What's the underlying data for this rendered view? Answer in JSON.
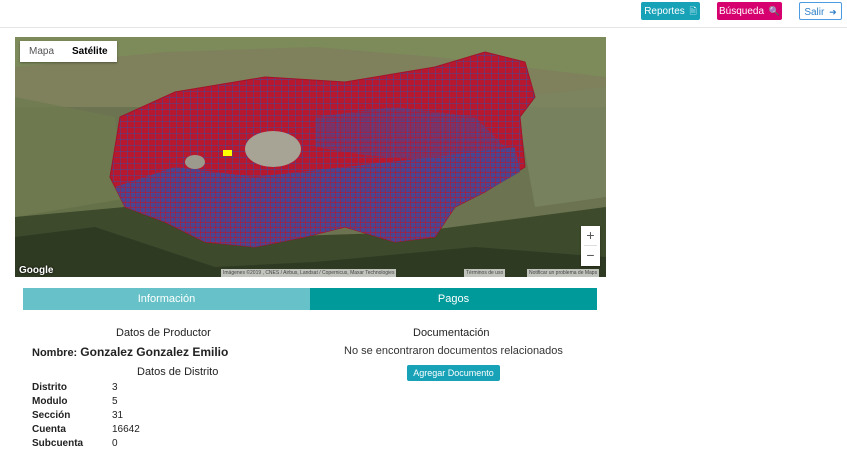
{
  "topbar": {
    "reportes_label": "Reportes",
    "busqueda_label": "Búsqueda",
    "salir_label": "Salir",
    "icons": [
      "document-icon",
      "search-icon",
      "logout-icon"
    ]
  },
  "map": {
    "toggle": [
      "Mapa",
      "Satélite"
    ],
    "selected_view": "Satélite",
    "zoom_in": "+",
    "zoom_out": "−",
    "google_label": "Google",
    "attribution": "Imágenes ©2019 , CNES / Airbus, Landsat / Copernicus, Maxar Technologies",
    "terms": "Términos de uso",
    "report": "Notificar un problema de Maps",
    "colors": {
      "parcel_red": "#c0162c",
      "parcel_blue": "#3b4c9e",
      "highlight": "#ffff00"
    }
  },
  "tabs": [
    {
      "label": "Información",
      "color": "#66c2c8"
    },
    {
      "label": "Pagos",
      "color": "#009a9a"
    }
  ],
  "productor": {
    "section_title": "Datos de Productor",
    "name_label": "Nombre:",
    "name_value": "Gonzalez Gonzalez Emilio"
  },
  "distrito": {
    "section_title": "Datos de Distrito",
    "rows": [
      {
        "key": "Distrito",
        "value": "3"
      },
      {
        "key": "Modulo",
        "value": "5"
      },
      {
        "key": "Sección",
        "value": "31"
      },
      {
        "key": "Cuenta",
        "value": "16642"
      },
      {
        "key": "Subcuenta",
        "value": "0"
      }
    ]
  },
  "documentacion": {
    "section_title": "Documentación",
    "empty_text": "No se encontraron documentos relacionados",
    "add_label": "Agregar Documento"
  }
}
